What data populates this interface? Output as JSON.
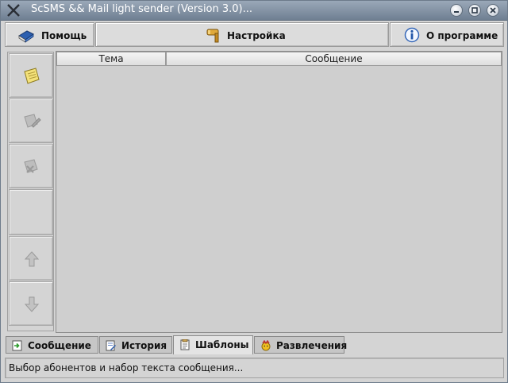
{
  "window": {
    "title": "ScSMS && Mail light sender (Version 3.0)..."
  },
  "toolbar": {
    "help_label": "Помощь",
    "settings_label": "Настройка",
    "about_label": "О программе"
  },
  "table": {
    "columns": [
      "Тема",
      "Сообщение"
    ],
    "rows": []
  },
  "tabs": [
    {
      "label": "Сообщение",
      "icon": "message-icon"
    },
    {
      "label": "История",
      "icon": "history-icon"
    },
    {
      "label": "Шаблоны",
      "icon": "templates-icon",
      "active": true
    },
    {
      "label": "Развлечения",
      "icon": "fun-icon"
    }
  ],
  "status": {
    "text": "Выбор абонентов и набор текста сообщения..."
  },
  "colors": {
    "titlebar": "#7f8ea1",
    "window_bg": "#d4d4d4",
    "note_yellow": "#f4e27a"
  }
}
